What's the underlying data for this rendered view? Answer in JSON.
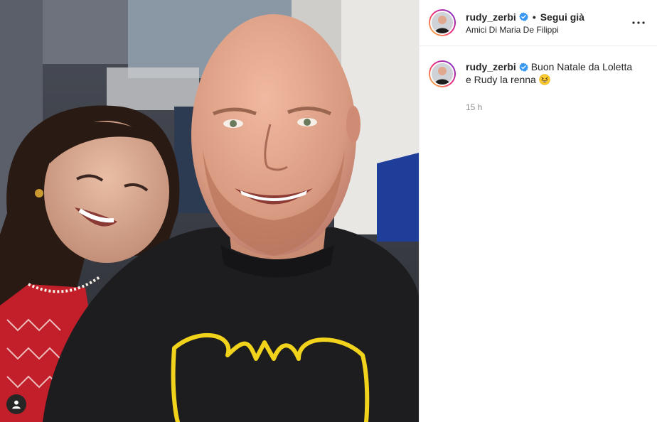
{
  "post": {
    "author": {
      "username": "rudy_zerbi",
      "verified": true,
      "follow_label": "Segui già",
      "location": "Amici Di Maria De Filippi"
    },
    "caption": {
      "username": "rudy_zerbi",
      "text": "Buon Natale da Loletta e Rudy la renna",
      "emoji": "grinning-squinting-face-icon",
      "timestamp": "15 h"
    }
  },
  "colors": {
    "verified": "#3897f0",
    "ring_start": "#f9ce34",
    "ring_end": "#6228d7",
    "text_primary": "#262626",
    "text_secondary": "#8e8e8e"
  },
  "icons": [
    "verified-badge-icon",
    "more-options-icon",
    "user-tag-icon"
  ]
}
